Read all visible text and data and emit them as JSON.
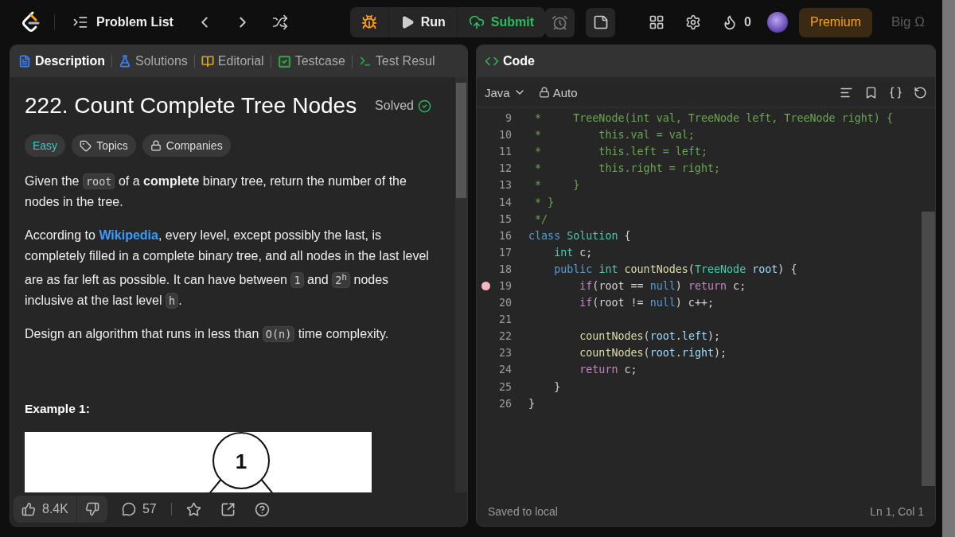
{
  "top_bar": {
    "problem_list": "Problem List",
    "run": "Run",
    "submit": "Submit",
    "streak": "0",
    "premium": "Premium",
    "user": "Big Ω"
  },
  "description_panel": {
    "tabs": [
      {
        "label": "Description",
        "kind": "description",
        "selected": true,
        "color": "#3b82f6"
      },
      {
        "label": "Solutions",
        "kind": "solutions",
        "selected": false,
        "color": "#3b82f6"
      },
      {
        "label": "Editorial",
        "kind": "editorial",
        "selected": false,
        "color": "#d4a72c"
      },
      {
        "label": "Testcase",
        "kind": "testcase",
        "selected": false,
        "color": "#2ea043"
      },
      {
        "label": "Test Resul",
        "kind": "result",
        "selected": false,
        "color": "#2ea043"
      }
    ],
    "title": "222. Count Complete Tree Nodes",
    "status": "Solved",
    "tags": [
      {
        "label": "Easy",
        "kind": "difficulty"
      },
      {
        "label": "Topics",
        "kind": "topics"
      },
      {
        "label": "Companies",
        "kind": "companies"
      }
    ],
    "paragraphs": [
      [
        {
          "kind": "text",
          "text": "Given the "
        },
        {
          "kind": "code",
          "text": "root"
        },
        {
          "kind": "text",
          "text": " of a "
        },
        {
          "kind": "bold",
          "text": "complete"
        },
        {
          "kind": "text",
          "text": " binary tree, return the number of the nodes in the tree."
        }
      ],
      [
        {
          "kind": "text",
          "text": "According to "
        },
        {
          "kind": "link",
          "text": "Wikipedia"
        },
        {
          "kind": "text",
          "text": ", every level, except possibly the last, is completely filled in a complete binary tree, and all nodes in the last level are as far left as possible. It can have between "
        },
        {
          "kind": "code",
          "text": "1"
        },
        {
          "kind": "text",
          "text": " and "
        },
        {
          "kind": "code",
          "text": "2$^{h}$"
        },
        {
          "kind": "text",
          "text": " nodes inclusive at the last level "
        },
        {
          "kind": "code",
          "text": "h"
        },
        {
          "kind": "text",
          "text": "."
        }
      ],
      [
        {
          "kind": "text",
          "text": "Design an algorithm that runs in less than "
        },
        {
          "kind": "code",
          "text": "O(n)"
        },
        {
          "kind": "text",
          "text": " time complexity."
        }
      ]
    ],
    "example_heading": "Example 1:",
    "example_node": "1",
    "likes": "8.4K",
    "comments": "57"
  },
  "code_panel": {
    "title": "Code",
    "language": "Java",
    "mode": "Auto",
    "lines": [
      {
        "number": "9",
        "breakpoint": false,
        "tokens": [
          {
            "kind": "comment",
            "text": " *     TreeNode(int val, TreeNode left, TreeNode right) {"
          }
        ]
      },
      {
        "number": "10",
        "breakpoint": false,
        "tokens": [
          {
            "kind": "comment",
            "text": " *         this.val = val;"
          }
        ]
      },
      {
        "number": "11",
        "breakpoint": false,
        "tokens": [
          {
            "kind": "comment",
            "text": " *         this.left = left;"
          }
        ]
      },
      {
        "number": "12",
        "breakpoint": false,
        "tokens": [
          {
            "kind": "comment",
            "text": " *         this.right = right;"
          }
        ]
      },
      {
        "number": "13",
        "breakpoint": false,
        "tokens": [
          {
            "kind": "comment",
            "text": " *     }"
          }
        ]
      },
      {
        "number": "14",
        "breakpoint": false,
        "tokens": [
          {
            "kind": "comment",
            "text": " * }"
          }
        ]
      },
      {
        "number": "15",
        "breakpoint": false,
        "tokens": [
          {
            "kind": "comment",
            "text": " */"
          }
        ]
      },
      {
        "number": "16",
        "breakpoint": false,
        "tokens": [
          {
            "kind": "keyword",
            "text": "class"
          },
          {
            "kind": "type",
            "text": " Solution"
          },
          {
            "kind": "plain",
            "text": " {"
          }
        ]
      },
      {
        "number": "17",
        "breakpoint": false,
        "tokens": [
          {
            "kind": "type",
            "text": "    int"
          },
          {
            "kind": "plain",
            "text": " c;"
          }
        ]
      },
      {
        "number": "18",
        "breakpoint": false,
        "tokens": [
          {
            "kind": "keyword",
            "text": "    public"
          },
          {
            "kind": "type",
            "text": " int"
          },
          {
            "kind": "fn",
            "text": " countNodes"
          },
          {
            "kind": "plain",
            "text": "("
          },
          {
            "kind": "type",
            "text": "TreeNode"
          },
          {
            "kind": "var",
            "text": " root"
          },
          {
            "kind": "plain",
            "text": ") {"
          }
        ]
      },
      {
        "number": "19",
        "breakpoint": true,
        "tokens": [
          {
            "kind": "control",
            "text": "        if"
          },
          {
            "kind": "plain",
            "text": "(root == "
          },
          {
            "kind": "keyword",
            "text": "null"
          },
          {
            "kind": "plain",
            "text": ") "
          },
          {
            "kind": "control",
            "text": "return"
          },
          {
            "kind": "plain",
            "text": " c;"
          }
        ]
      },
      {
        "number": "20",
        "breakpoint": false,
        "tokens": [
          {
            "kind": "control",
            "text": "        if"
          },
          {
            "kind": "plain",
            "text": "(root != "
          },
          {
            "kind": "keyword",
            "text": "null"
          },
          {
            "kind": "plain",
            "text": ") c++;"
          }
        ]
      },
      {
        "number": "21",
        "breakpoint": false
      },
      {
        "number": "22",
        "breakpoint": false,
        "tokens": [
          {
            "kind": "fn",
            "text": "        countNodes"
          },
          {
            "kind": "plain",
            "text": "("
          },
          {
            "kind": "var",
            "text": "root"
          },
          {
            "kind": "plain",
            "text": "."
          },
          {
            "kind": "var",
            "text": "left"
          },
          {
            "kind": "plain",
            "text": ");"
          }
        ]
      },
      {
        "number": "23",
        "breakpoint": false,
        "tokens": [
          {
            "kind": "fn",
            "text": "        countNodes"
          },
          {
            "kind": "plain",
            "text": "("
          },
          {
            "kind": "var",
            "text": "root"
          },
          {
            "kind": "plain",
            "text": "."
          },
          {
            "kind": "var",
            "text": "right"
          },
          {
            "kind": "plain",
            "text": ");"
          }
        ]
      },
      {
        "number": "24",
        "breakpoint": false,
        "tokens": [
          {
            "kind": "control",
            "text": "        return"
          },
          {
            "kind": "plain",
            "text": " c;"
          }
        ]
      },
      {
        "number": "25",
        "breakpoint": false,
        "tokens": [
          {
            "kind": "plain",
            "text": "    }"
          }
        ]
      },
      {
        "number": "26",
        "breakpoint": false,
        "tokens": [
          {
            "kind": "plain",
            "text": "}"
          }
        ]
      }
    ],
    "save_status": "Saved to local",
    "cursor": "Ln 1, Col 1"
  }
}
